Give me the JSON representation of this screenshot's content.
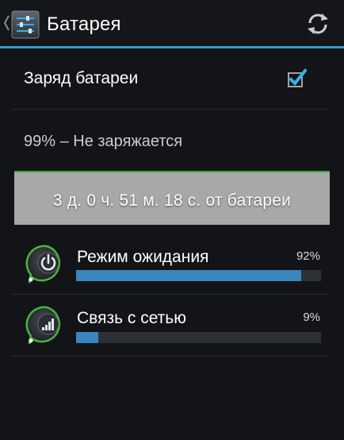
{
  "actionbar": {
    "title": "Батарея",
    "app_icon": "settings-sliders-icon",
    "back_icon": "chevron-left-icon",
    "refresh_icon": "refresh-icon",
    "accent_color": "#2e9ad0"
  },
  "battery_charge": {
    "label": "Заряд батареи",
    "checked": true,
    "checkbox_color": "#33b5e5"
  },
  "status": {
    "text": "99% – Не заряжается"
  },
  "usage_time": {
    "text": "3 д. 0 ч. 51 м. 18 с. от батареи",
    "band_color": "#a8a8a8",
    "line_color": "#3aa83a"
  },
  "usage_items": [
    {
      "name": "Режим ожидания",
      "percent_label": "92%",
      "fraction": 0.92,
      "icon": "power-icon",
      "bar_color": "#3a86bd"
    },
    {
      "name": "Связь с сетью",
      "percent_label": "9%",
      "fraction": 0.09,
      "icon": "signal-bars-icon",
      "bar_color": "#3a86bd"
    }
  ]
}
